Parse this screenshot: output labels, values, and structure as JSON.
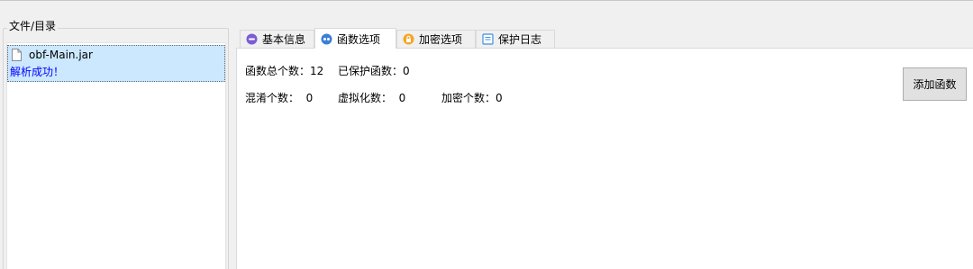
{
  "left_panel": {
    "group_title": "文件/目录",
    "file_name": "obf-Main.jar",
    "file_status": "解析成功！"
  },
  "tabs": [
    {
      "label": "基本信息",
      "icon": "chat-bubble-icon",
      "active": false
    },
    {
      "label": "函数选项",
      "icon": "function-icon",
      "active": true
    },
    {
      "label": "加密选项",
      "icon": "lock-icon",
      "active": false
    },
    {
      "label": "保护日志",
      "icon": "log-icon",
      "active": false
    }
  ],
  "stats": {
    "total_functions": "函数总个数：12",
    "protected_functions": "已保护函数：0",
    "obfuscated_count": "混淆个数：  0",
    "virtualized_count": "虚拟化数：  0",
    "encrypted_count": "加密个数：0"
  },
  "buttons": {
    "add_function": "添加函数"
  },
  "colors": {
    "selection_bg": "#cce8ff",
    "status_text": "#0000ff",
    "window_bg": "#f0f0f0"
  }
}
